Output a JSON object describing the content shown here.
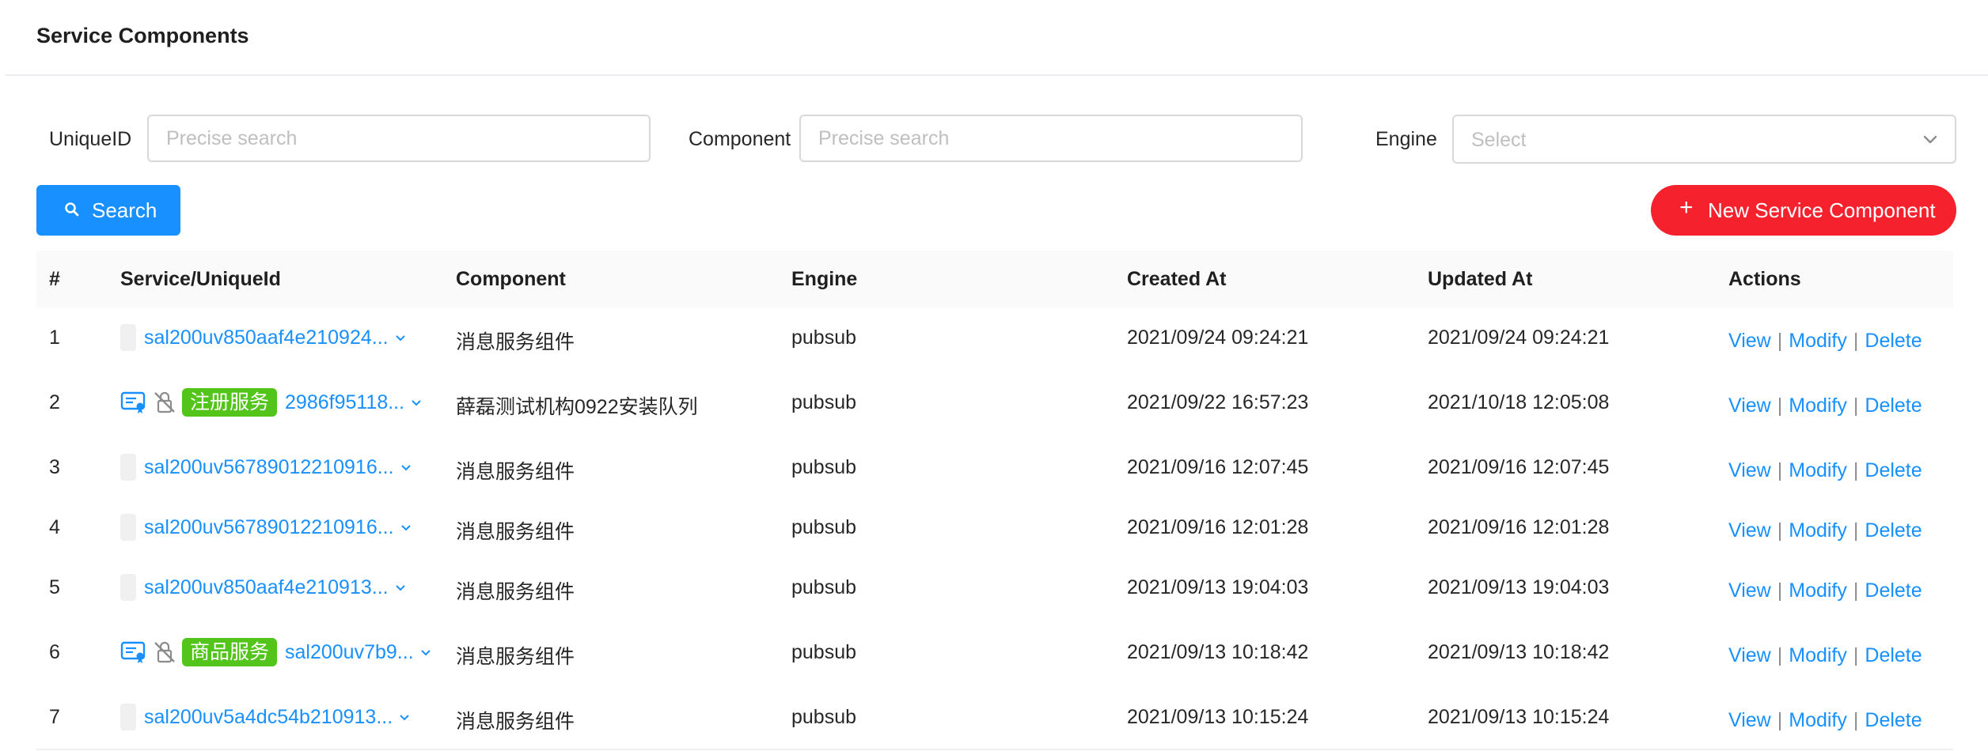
{
  "page": {
    "title": "Service Components"
  },
  "filters": {
    "uniqueid_label": "UniqueID",
    "uniqueid_placeholder": "Precise search",
    "component_label": "Component",
    "component_placeholder": "Precise search",
    "engine_label": "Engine",
    "engine_placeholder": "Select"
  },
  "buttons": {
    "search": "Search",
    "new": "New Service Component"
  },
  "table": {
    "headers": [
      "#",
      "Service/UniqueId",
      "Component",
      "Engine",
      "Created At",
      "Updated At",
      "Actions"
    ],
    "rows": [
      {
        "num": "1",
        "uid": "sal200uv850aaf4e210924...",
        "component": "消息服务组件",
        "engine": "pubsub",
        "created": "2021/09/24 09:24:21",
        "updated": "2021/09/24 09:24:21"
      },
      {
        "num": "2",
        "tag": "注册服务",
        "uid": "2986f95118...",
        "component": "薛磊测试机构0922安装队列",
        "engine": "pubsub",
        "created": "2021/09/22 16:57:23",
        "updated": "2021/10/18 12:05:08"
      },
      {
        "num": "3",
        "uid": "sal200uv56789012210916...",
        "component": "消息服务组件",
        "engine": "pubsub",
        "created": "2021/09/16 12:07:45",
        "updated": "2021/09/16 12:07:45"
      },
      {
        "num": "4",
        "uid": "sal200uv56789012210916...",
        "component": "消息服务组件",
        "engine": "pubsub",
        "created": "2021/09/16 12:01:28",
        "updated": "2021/09/16 12:01:28"
      },
      {
        "num": "5",
        "uid": "sal200uv850aaf4e210913...",
        "component": "消息服务组件",
        "engine": "pubsub",
        "created": "2021/09/13 19:04:03",
        "updated": "2021/09/13 19:04:03"
      },
      {
        "num": "6",
        "tag": "商品服务",
        "uid": "sal200uv7b9...",
        "component": "消息服务组件",
        "engine": "pubsub",
        "created": "2021/09/13 10:18:42",
        "updated": "2021/09/13 10:18:42"
      },
      {
        "num": "7",
        "uid": "sal200uv5a4dc54b210913...",
        "component": "消息服务组件",
        "engine": "pubsub",
        "created": "2021/09/13 10:15:24",
        "updated": "2021/09/13 10:15:24"
      }
    ],
    "actions": {
      "view": "View",
      "modify": "Modify",
      "delete": "Delete",
      "separator": "|"
    }
  },
  "colors": {
    "primary": "#1890ff",
    "danger": "#f5222d",
    "tag_green": "#52c41a"
  },
  "icons": [
    "search-icon",
    "plus-icon",
    "chevron-down-icon",
    "certificate-icon",
    "lock-off-icon"
  ]
}
